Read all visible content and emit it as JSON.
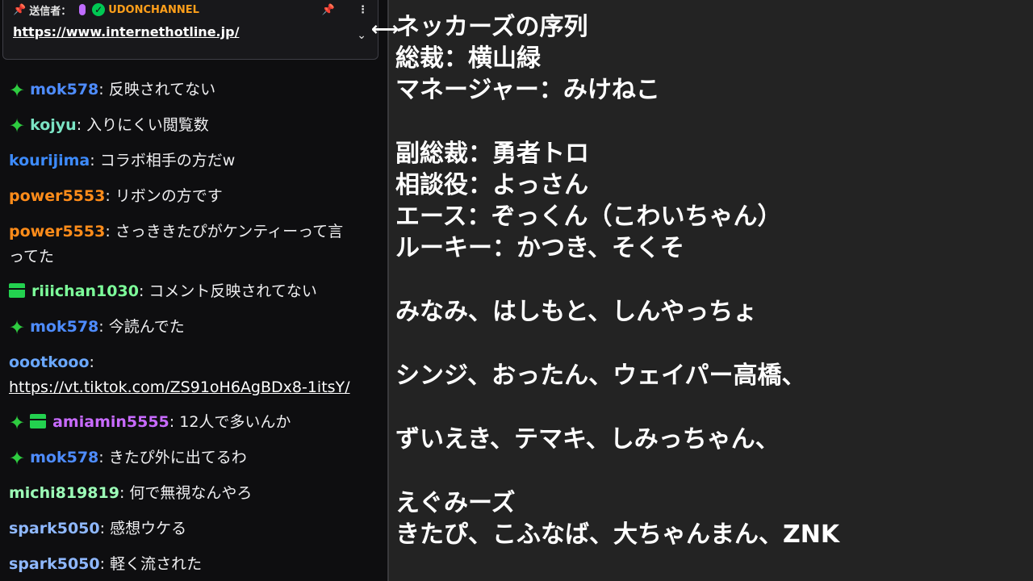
{
  "pinned": {
    "sender_label": "送信者：",
    "channel": "UDONCHANNEL",
    "link": "https://www.internethotline.jp/"
  },
  "chat": [
    {
      "badges": [],
      "user": "",
      "color": "#ffffff",
      "text": ""
    },
    {
      "badges": [
        "sparkle"
      ],
      "user": "mok578",
      "color": "#4e8cff",
      "text": "反映されてない"
    },
    {
      "badges": [
        "sparkle"
      ],
      "user": "kojyu",
      "color": "#7be3c4",
      "text": "入りにくい閲覧数"
    },
    {
      "badges": [],
      "user": "kourijima",
      "color": "#3d8bfd",
      "text": "コラボ相手の方だw"
    },
    {
      "badges": [],
      "user": "power5553",
      "color": "#ff8c1a",
      "text": "リボンの方です"
    },
    {
      "badges": [],
      "user": "power5553",
      "color": "#ff8c1a",
      "text": "さっききたぴがケンティーって言",
      "text2": "ってた"
    },
    {
      "badges": [
        "gift"
      ],
      "user": "riiichan1030",
      "color": "#7dff9a",
      "text": "コメント反映されてない"
    },
    {
      "badges": [
        "sparkle"
      ],
      "user": "mok578",
      "color": "#4e8cff",
      "text": "今読んでた"
    },
    {
      "badges": [],
      "user": "oootkooo",
      "color": "#6aa8ff",
      "text": "",
      "link": "https://vt.tiktok.com/ZS91oH6AgBDx8-1itsY/"
    },
    {
      "badges": [
        "sparkle",
        "gift"
      ],
      "user": "amiamin5555",
      "color": "#c86bff",
      "text": "12人で多いんか"
    },
    {
      "badges": [
        "sparkle"
      ],
      "user": "mok578",
      "color": "#4e8cff",
      "text": "きたぴ外に出てるわ"
    },
    {
      "badges": [],
      "user": "michi819819",
      "color": "#9dffb8",
      "text": "何で無視なんやろ"
    },
    {
      "badges": [],
      "user": "spark5050",
      "color": "#8fb8ff",
      "text": "感想ウケる"
    },
    {
      "badges": [],
      "user": "spark5050",
      "color": "#8fb8ff",
      "text": "軽く流された"
    }
  ],
  "stream_lines": [
    "ネッカーズの序列",
    "総裁：横山緑",
    "マネージャー：みけねこ",
    "",
    "副総裁：勇者トロ",
    "相談役：よっさん",
    "エース：ぞっくん（こわいちゃん）",
    "ルーキー：かつき、そくそ",
    "",
    "みなみ、はしもと、しんやっちょ",
    "",
    "シンジ、おったん、ウェイパー高橋、",
    "",
    "ずいえき、テマキ、しみっちゃん、",
    "",
    "えぐみーズ",
    "きたぴ、こふなば、大ちゃんまん、ZNK"
  ]
}
